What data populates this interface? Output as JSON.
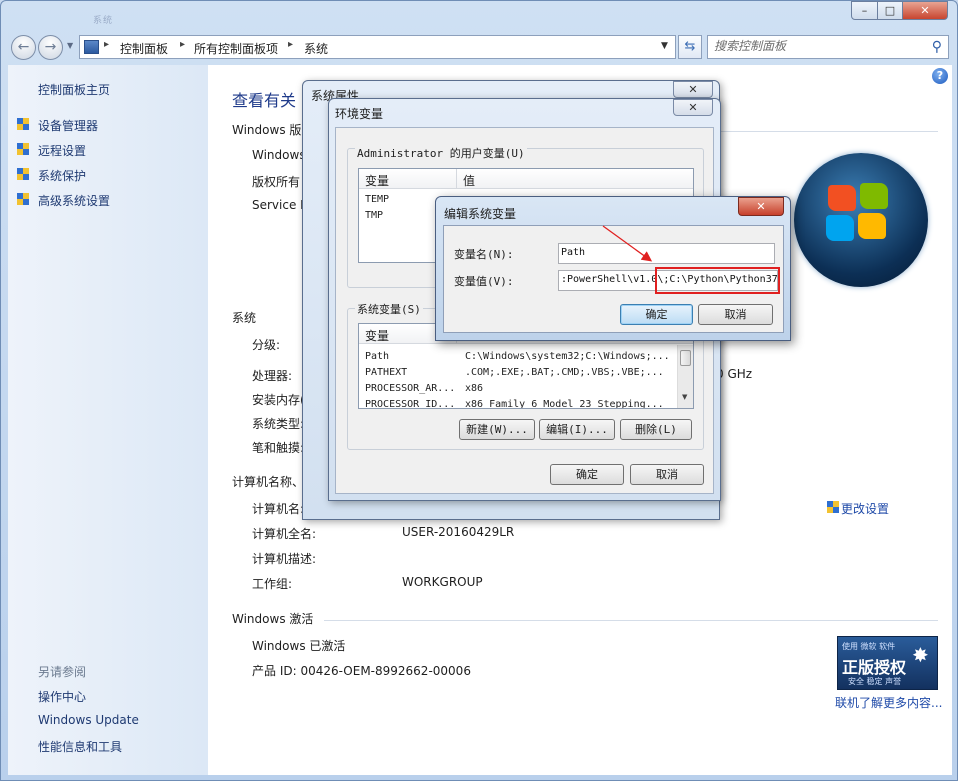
{
  "window": {
    "title_faded": "系统",
    "controls": {
      "minimize": "–",
      "maximize": "□",
      "close": "✕"
    }
  },
  "address_bar": {
    "crumbs": [
      "控制面板",
      "所有控制面板项",
      "系统"
    ],
    "separator": "▸",
    "search_placeholder": "搜索控制面板"
  },
  "sidebar": {
    "home": "控制面板主页",
    "items": [
      "设备管理器",
      "远程设置",
      "系统保护",
      "高级系统设置"
    ],
    "see_also": "另请参阅",
    "see_also_items": [
      "操作中心",
      "Windows Update",
      "性能信息和工具"
    ]
  },
  "content": {
    "heading": "查看有关",
    "edition_section": "Windows 版",
    "edition_lines": [
      "Windows",
      "版权所有",
      "Service P"
    ],
    "system_section": "系统",
    "system_labels": [
      "分级:",
      "处理器:",
      "安装内存(",
      "系统类型:",
      "笔和触摸:"
    ],
    "processor_tail": "0 GHz",
    "computer_section": "计算机名称、",
    "computer_labels": [
      "计算机名:",
      "计算机全名:",
      "计算机描述:",
      "工作组:"
    ],
    "computer_full_name": "USER-20160429LR",
    "workgroup": "WORKGROUP",
    "change_settings": "更改设置",
    "activation_section": "Windows 激活",
    "activated": "Windows 已激活",
    "product_id": "产品 ID: 00426-OEM-8992662-00006",
    "genuine_top": "使用 微软 软件",
    "genuine_main": "正版授权",
    "genuine_sub": "安全 稳定 声誉",
    "learn_more": "联机了解更多内容..."
  },
  "sysprop_dialog": {
    "title": "系统属性",
    "close": "✕"
  },
  "env_dialog": {
    "title": "环境变量",
    "close": "✕",
    "user_group": "Administrator 的用户变量(U)",
    "col_var": "变量",
    "col_val": "值",
    "user_rows": [
      {
        "name": "TEMP"
      },
      {
        "name": "TMP"
      }
    ],
    "sys_group": "系统变量(S)",
    "sys_rows": [
      {
        "name": "Path",
        "value": "C:\\Windows\\system32;C:\\Windows;..."
      },
      {
        "name": "PATHEXT",
        "value": ".COM;.EXE;.BAT;.CMD;.VBS;.VBE;..."
      },
      {
        "name": "PROCESSOR_AR...",
        "value": "x86"
      },
      {
        "name": "PROCESSOR_ID...",
        "value": "x86 Family 6 Model 23 Stepping..."
      }
    ],
    "new_btn": "新建(W)...",
    "edit_btn": "编辑(I)...",
    "delete_btn": "删除(L)",
    "ok_btn": "确定",
    "cancel_btn": "取消"
  },
  "edit_dialog": {
    "title": "编辑系统变量",
    "close": "✕",
    "name_label": "变量名(N):",
    "name_value": "Path",
    "value_label": "变量值(V):",
    "value_value": ":PowerShell\\v1.0\\;C:\\Python\\Python37",
    "ok_btn": "确定",
    "cancel_btn": "取消"
  },
  "colors": {
    "highlight_box": "#e02020",
    "link": "#1f4aa8",
    "heading": "#1e3a8a"
  }
}
